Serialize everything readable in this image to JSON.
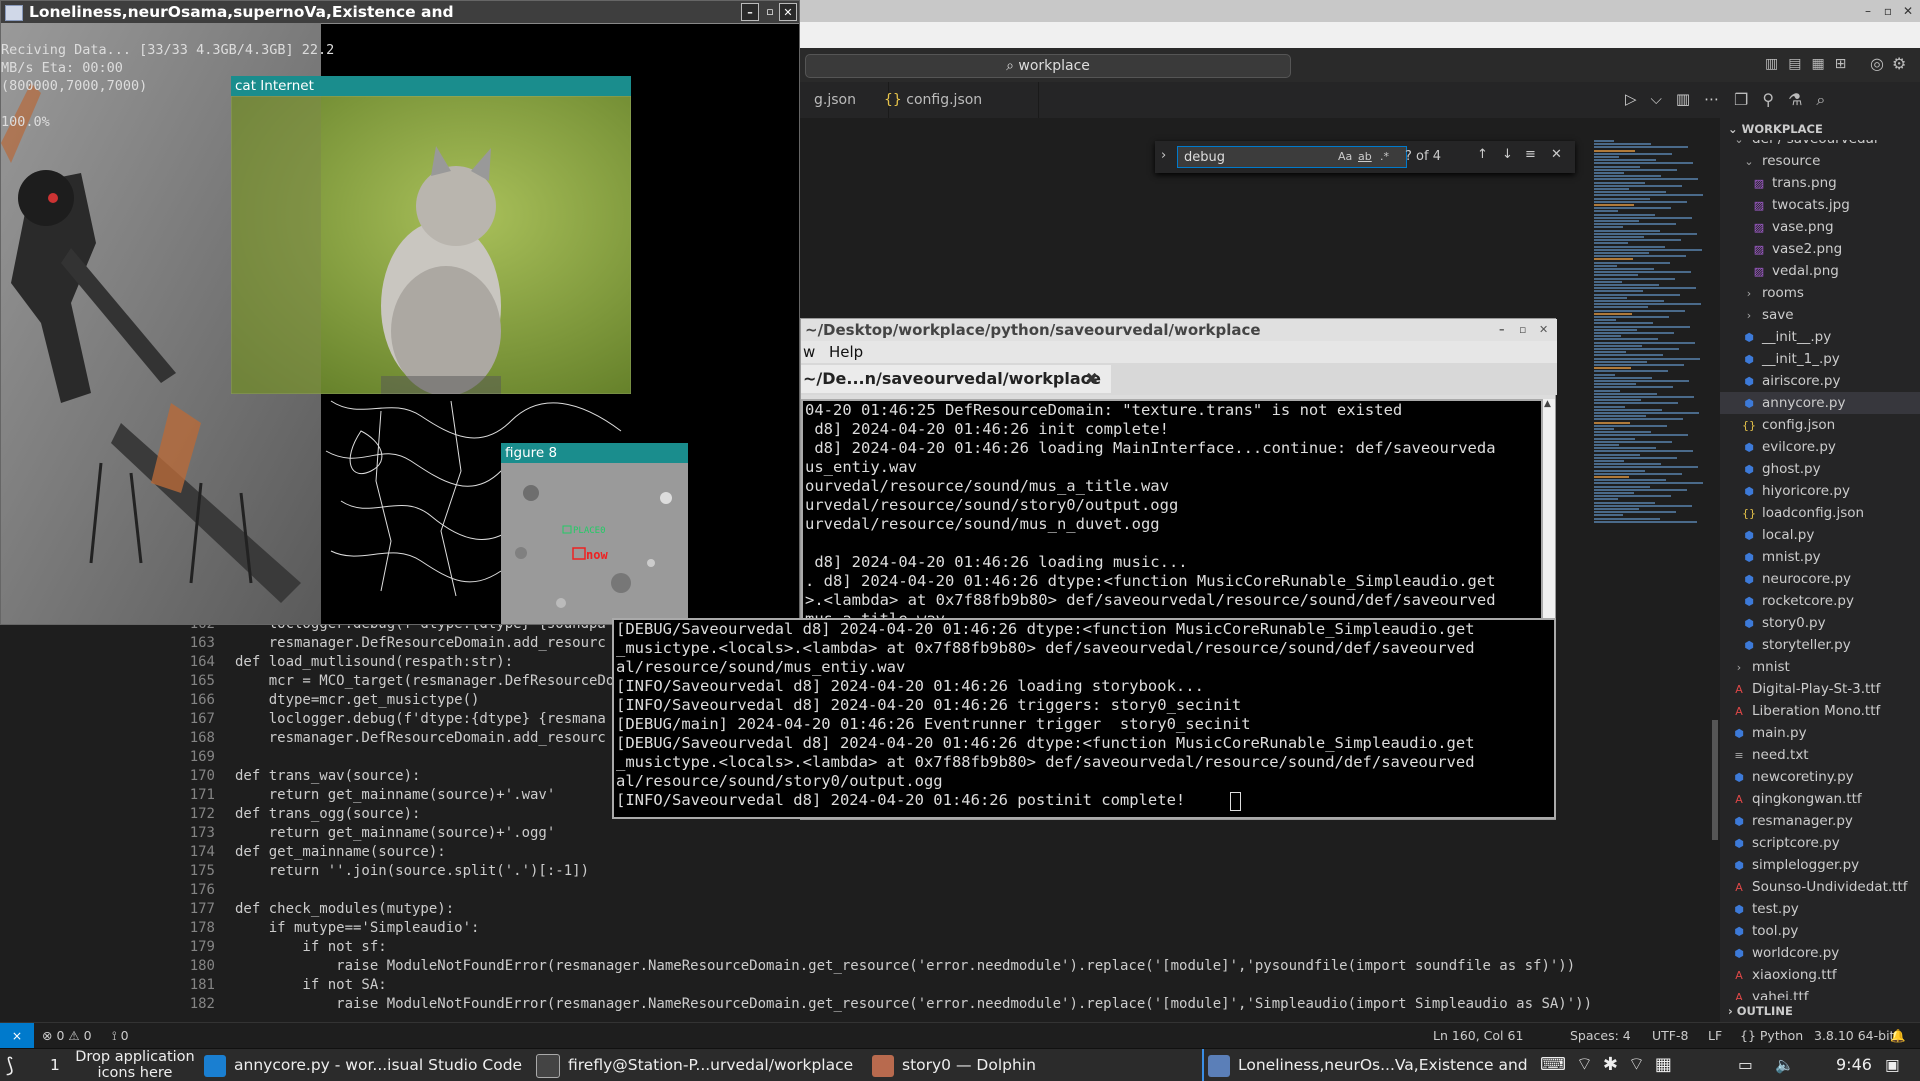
{
  "vscode": {
    "command_search": "workplace",
    "tabs": [
      {
        "label": "g.json",
        "icon": "json-icon"
      },
      {
        "label": "config.json",
        "icon": "json-icon"
      }
    ],
    "find": {
      "query": "debug",
      "case_label": "Aa",
      "word_label": "ab",
      "regex_label": ".*",
      "count": "? of 4"
    },
    "code": [
      {
        "ln": "162",
        "text": "    loclogger.debug(f'dtype:{dtype} {soundpa"
      },
      {
        "ln": "163",
        "text": "    resmanager.DefResourceDomain.add_resourc"
      },
      {
        "ln": "164",
        "text": "def load_mutlisound(respath:str):"
      },
      {
        "ln": "165",
        "text": "    mcr = MCO_target(resmanager.DefResourceDo"
      },
      {
        "ln": "166",
        "text": "    dtype=mcr.get_musictype()"
      },
      {
        "ln": "167",
        "text": "    loclogger.debug(f'dtype:{dtype} {resmana"
      },
      {
        "ln": "168",
        "text": "    resmanager.DefResourceDomain.add_resourc"
      },
      {
        "ln": "169",
        "text": ""
      },
      {
        "ln": "170",
        "text": "def trans_wav(source):"
      },
      {
        "ln": "171",
        "text": "    return get_mainname(source)+'.wav'"
      },
      {
        "ln": "172",
        "text": "def trans_ogg(source):"
      },
      {
        "ln": "173",
        "text": "    return get_mainname(source)+'.ogg'"
      },
      {
        "ln": "174",
        "text": "def get_mainname(source):"
      },
      {
        "ln": "175",
        "text": "    return ''.join(source.split('.')[:-1])"
      },
      {
        "ln": "176",
        "text": ""
      },
      {
        "ln": "177",
        "text": "def check_modules(mutype):"
      },
      {
        "ln": "178",
        "text": "    if mutype=='Simpleaudio':"
      },
      {
        "ln": "179",
        "text": "        if not sf:"
      },
      {
        "ln": "180",
        "text": "            raise ModuleNotFoundError(resmanager.NameResourceDomain.get_resource('error.needmodule').replace('[module]','pysoundfile(import soundfile as sf)'))"
      },
      {
        "ln": "181",
        "text": "        if not SA:"
      },
      {
        "ln": "182",
        "text": "            raise ModuleNotFoundError(resmanager.NameResourceDomain.get_resource('error.needmodule').replace('[module]','Simpleaudio(import Simpleaudio as SA)'))"
      }
    ],
    "explorer": {
      "header": "WORKPLACE",
      "items": [
        {
          "label": "def / saveourvedal",
          "type": "folder-open",
          "depth": 0
        },
        {
          "label": "resource",
          "type": "folder-open",
          "depth": 1
        },
        {
          "label": "trans.png",
          "type": "img",
          "depth": 2
        },
        {
          "label": "twocats.jpg",
          "type": "img",
          "depth": 2
        },
        {
          "label": "vase.png",
          "type": "img",
          "depth": 2
        },
        {
          "label": "vase2.png",
          "type": "img",
          "depth": 2
        },
        {
          "label": "vedal.png",
          "type": "img",
          "depth": 2
        },
        {
          "label": "rooms",
          "type": "folder",
          "depth": 1
        },
        {
          "label": "save",
          "type": "folder",
          "depth": 1
        },
        {
          "label": "__init__.py",
          "type": "py",
          "depth": 1
        },
        {
          "label": "__init_1_.py",
          "type": "py",
          "depth": 1
        },
        {
          "label": "airiscore.py",
          "type": "py",
          "depth": 1
        },
        {
          "label": "annycore.py",
          "type": "py",
          "depth": 1,
          "selected": true
        },
        {
          "label": "config.json",
          "type": "json",
          "depth": 1
        },
        {
          "label": "evilcore.py",
          "type": "py",
          "depth": 1
        },
        {
          "label": "ghost.py",
          "type": "py",
          "depth": 1
        },
        {
          "label": "hiyoricore.py",
          "type": "py",
          "depth": 1
        },
        {
          "label": "loadconfig.json",
          "type": "json",
          "depth": 1
        },
        {
          "label": "local.py",
          "type": "py",
          "depth": 1
        },
        {
          "label": "mnist.py",
          "type": "py",
          "depth": 1
        },
        {
          "label": "neurocore.py",
          "type": "py",
          "depth": 1
        },
        {
          "label": "rocketcore.py",
          "type": "py",
          "depth": 1
        },
        {
          "label": "story0.py",
          "type": "py",
          "depth": 1
        },
        {
          "label": "storyteller.py",
          "type": "py",
          "depth": 1
        },
        {
          "label": "mnist",
          "type": "folder",
          "depth": 0
        },
        {
          "label": "Digital-Play-St-3.ttf",
          "type": "ttf",
          "depth": 0
        },
        {
          "label": "Liberation Mono.ttf",
          "type": "ttf",
          "depth": 0
        },
        {
          "label": "main.py",
          "type": "py",
          "depth": 0
        },
        {
          "label": "need.txt",
          "type": "txt",
          "depth": 0
        },
        {
          "label": "newcoretiny.py",
          "type": "py",
          "depth": 0
        },
        {
          "label": "qingkongwan.ttf",
          "type": "ttf",
          "depth": 0
        },
        {
          "label": "resmanager.py",
          "type": "py",
          "depth": 0
        },
        {
          "label": "scriptcore.py",
          "type": "py",
          "depth": 0
        },
        {
          "label": "simplelogger.py",
          "type": "py",
          "depth": 0
        },
        {
          "label": "Sounso-Undividedat.ttf",
          "type": "ttf",
          "depth": 0
        },
        {
          "label": "test.py",
          "type": "py",
          "depth": 0
        },
        {
          "label": "tool.py",
          "type": "py",
          "depth": 0
        },
        {
          "label": "worldcore.py",
          "type": "py",
          "depth": 0
        },
        {
          "label": "xiaoxiong.ttf",
          "type": "ttf",
          "depth": 0
        },
        {
          "label": "yahei.ttf",
          "type": "ttf",
          "depth": 0
        }
      ],
      "outline": "OUTLINE"
    },
    "status": {
      "errors": "0",
      "warnings": "0",
      "ports": "0",
      "position": "Ln 160, Col 61",
      "spaces": "Spaces: 4",
      "encoding": "UTF-8",
      "eol": "LF",
      "language": "Python",
      "interpreter": "3.8.10 64-bit"
    }
  },
  "lonely_window": {
    "title": "Loneliness,neurOsama,supernoVa,Existence and",
    "console_lines": [
      "Reciving Data... [33/33 4.3GB/4.3GB] 22.2",
      "MB/s Eta: 00:00",
      "(800000,7000,7000)",
      "",
      "100.0%"
    ],
    "cat_window_title": "cat Internet",
    "figure_title": "figure 8",
    "figure_label_place": "PLACE0",
    "figure_label_now": "now"
  },
  "terminal": {
    "title": "~/Desktop/workplace/python/saveourvedal/workplace",
    "menu": [
      "w",
      "Help"
    ],
    "tab_label": "~/De...n/saveourvedal/workplace",
    "lines": [
      "04-20 01:46:25 DefResourceDomain: \"texture.trans\" is not existed",
      " d8] 2024-04-20 01:46:26 init complete!",
      " d8] 2024-04-20 01:46:26 loading MainInterface...continue: def/saveourveda",
      "us_entiy.wav",
      "ourvedal/resource/sound/mus_a_title.wav",
      "urvedal/resource/sound/story0/output.ogg",
      "urvedal/resource/sound/mus_n_duvet.ogg",
      "",
      " d8] 2024-04-20 01:46:26 loading music...",
      ". d8] 2024-04-20 01:46:26 dtype:<function MusicCoreRunable_Simpleaudio.get",
      ">.<lambda> at 0x7f88fb9b80> def/saveourvedal/resource/sound/def/saveourved",
      "mus_a_title.wav"
    ],
    "ext_lines": [
      "[DEBUG/Saveourvedal d8] 2024-04-20 01:46:26 dtype:<function MusicCoreRunable_Simpleaudio.get",
      "_musictype.<locals>.<lambda> at 0x7f88fb9b80> def/saveourvedal/resource/sound/def/saveourved",
      "al/resource/sound/mus_entiy.wav",
      "[INFO/Saveourvedal d8] 2024-04-20 01:46:26 loading storybook...",
      "[INFO/Saveourvedal d8] 2024-04-20 01:46:26 triggers: story0_secinit",
      "[DEBUG/main] 2024-04-20 01:46:26 Eventrunner trigger  story0_secinit",
      "[DEBUG/Saveourvedal d8] 2024-04-20 01:46:26 dtype:<function MusicCoreRunable_Simpleaudio.get",
      "_musictype.<locals>.<lambda> at 0x7f88fb9b80> def/saveourvedal/resource/sound/def/saveourved",
      "al/resource/sound/story0/output.ogg",
      "[INFO/Saveourvedal d8] 2024-04-20 01:46:26 postinit complete!"
    ]
  },
  "taskbar": {
    "workspace": "1",
    "drop_hint": "Drop application icons here",
    "tasks": [
      {
        "label": "annycore.py - wor...isual Studio Code",
        "icon": "vscode-icon"
      },
      {
        "label": "firefly@Station-P...urvedal/workplace",
        "icon": "terminal-icon"
      },
      {
        "label": "story0 — Dolphin",
        "icon": "folder-icon"
      },
      {
        "label": "Loneliness,neurOs...Va,Existence and",
        "icon": "window-icon"
      }
    ],
    "clock": "9:46"
  },
  "colors": {
    "accent": "#007acc",
    "subwindow_title": "#1a8d8d",
    "terminal_bg": "#000000"
  }
}
